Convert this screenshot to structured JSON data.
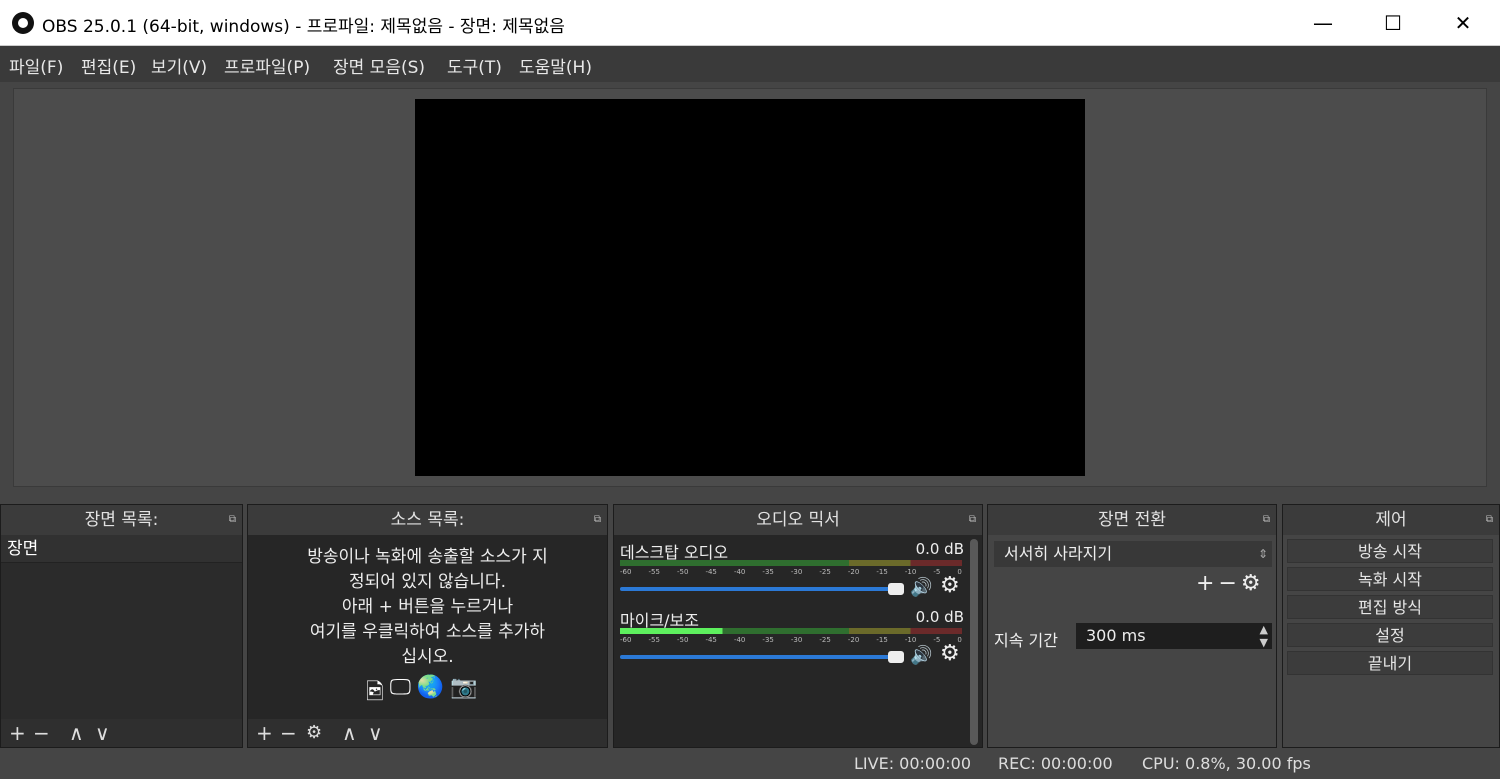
{
  "window": {
    "title": "OBS 25.0.1 (64-bit, windows) - 프로파일: 제목없음 - 장면: 제목없음",
    "min_icon": "—",
    "max_icon": "☐",
    "close_icon": "✕"
  },
  "menu": [
    "파일(F)",
    "편집(E)",
    "보기(V)",
    "프로파일(P)",
    "장면 모음(S)",
    "도구(T)",
    "도움말(H)"
  ],
  "scenes": {
    "header": "장면 목록:",
    "items": [
      "장면"
    ],
    "toolbar": [
      "+",
      "−",
      "∧",
      "∨"
    ]
  },
  "sources": {
    "header": "소스 목록:",
    "empty_line1": "방송이나 녹화에 송출할 소스가 지",
    "empty_line2": "정되어 있지 않습니다.",
    "empty_line3": "아래 + 버튼을 누르거나",
    "empty_line4": "여기를 우클릭하여 소스를 추가하",
    "empty_line5": "십시오.",
    "toolbar": [
      "+",
      "−",
      "⚙",
      "∧",
      "∨"
    ]
  },
  "mixer": {
    "header": "오디오 믹서",
    "ticks": [
      "-60",
      "-55",
      "-50",
      "-45",
      "-40",
      "-35",
      "-30",
      "-25",
      "-20",
      "-15",
      "-10",
      "-5",
      "0"
    ],
    "channels": [
      {
        "name": "데스크탑 오디오",
        "db": "0.0 dB"
      },
      {
        "name": "마이크/보조",
        "db": "0.0 dB"
      }
    ]
  },
  "transitions": {
    "header": "장면 전환",
    "selected": "서서히 사라지기",
    "duration_label": "지속 기간",
    "duration_value": "300 ms"
  },
  "controls": {
    "header": "제어",
    "buttons": [
      "방송 시작",
      "녹화 시작",
      "편집 방식",
      "설정",
      "끝내기"
    ]
  },
  "status": {
    "live": "LIVE: 00:00:00",
    "rec": "REC: 00:00:00",
    "cpu": "CPU: 0.8%, 30.00 fps"
  }
}
